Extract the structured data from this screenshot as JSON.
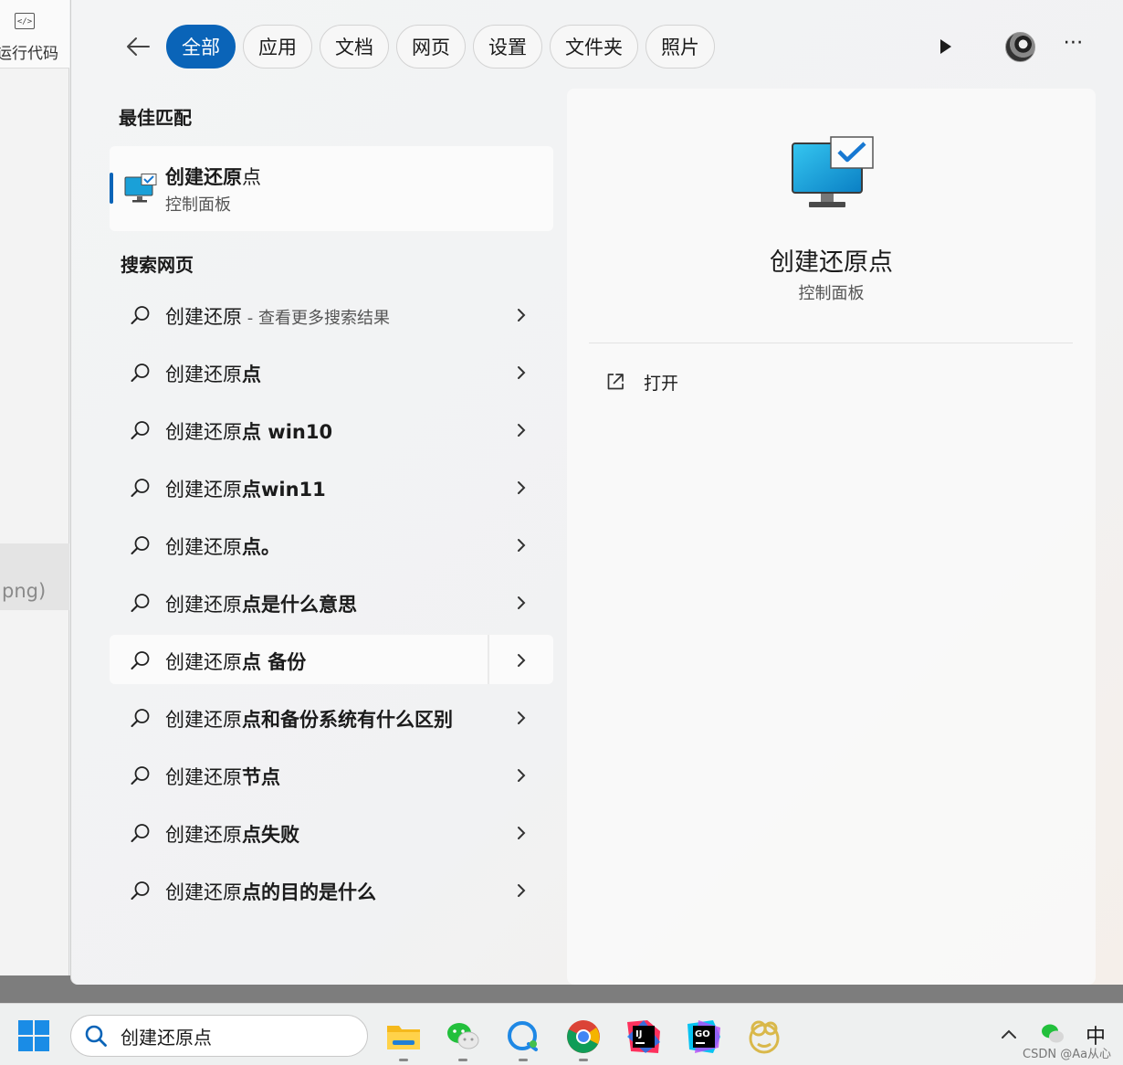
{
  "background_app": {
    "run_code_label": "运行代码",
    "file_ext_label": "png)"
  },
  "flyout": {
    "tabs": [
      {
        "label": "全部",
        "active": true
      },
      {
        "label": "应用"
      },
      {
        "label": "文档"
      },
      {
        "label": "网页"
      },
      {
        "label": "设置"
      },
      {
        "label": "文件夹"
      },
      {
        "label": "照片"
      }
    ],
    "best_match": {
      "section_label": "最佳匹配",
      "title_bold": "创建还原",
      "title_rest": "点",
      "subtitle": "控制面板"
    },
    "web_search": {
      "section_label": "搜索网页",
      "items": [
        {
          "query": "创建还原",
          "suffix_bold": "",
          "suffix": " - 查看更多搜索结果"
        },
        {
          "query": "创建还原",
          "suffix_bold": "点"
        },
        {
          "query": "创建还原",
          "suffix_bold": "点 win10"
        },
        {
          "query": "创建还原",
          "suffix_bold": "点win11"
        },
        {
          "query": "创建还原",
          "suffix_bold": "点。"
        },
        {
          "query": "创建还原",
          "suffix_bold": "点是什么意思"
        },
        {
          "query": "创建还原",
          "suffix_bold": "点 备份"
        },
        {
          "query": "创建还原",
          "suffix_bold": "点和备份系统有什么区别"
        },
        {
          "query": "创建还原",
          "suffix_bold": "节点"
        },
        {
          "query": "创建还原",
          "suffix_bold": "点失败"
        },
        {
          "query": "创建还原",
          "suffix_bold": "点的目的是什么"
        }
      ],
      "highlighted_index": 6
    },
    "detail": {
      "title": "创建还原点",
      "subtitle": "控制面板",
      "open_label": "打开"
    }
  },
  "taskbar": {
    "search_value": "创建还原点",
    "apps": [
      "file-explorer-icon",
      "wechat-icon",
      "chat-bubble-icon",
      "chrome-icon",
      "intellij-icon",
      "goland-icon",
      "navicat-icon"
    ],
    "ime_label": "中",
    "watermark": "CSDN @Aa从心"
  },
  "colors": {
    "accent": "#0a64b8",
    "start_blue": "#1a8ce6"
  }
}
